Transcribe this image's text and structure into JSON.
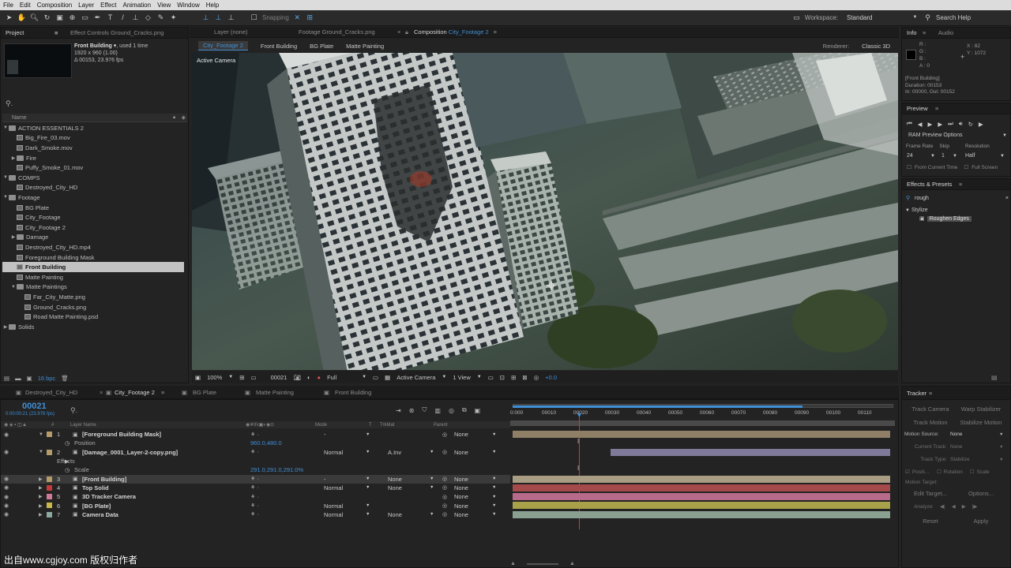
{
  "menubar": [
    "File",
    "Edit",
    "Composition",
    "Layer",
    "Effect",
    "Animation",
    "View",
    "Window",
    "Help"
  ],
  "toolbar": {
    "snapping": "Snapping",
    "workspace_label": "Workspace:",
    "workspace_value": "Standard",
    "search_help": "Search Help"
  },
  "project_panel": {
    "tabs": [
      "Project",
      "Effect Controls Ground_Cracks.png",
      "Layer (none)",
      "Footage Ground_Cracks.png"
    ],
    "comp_tab": "Composition",
    "comp_name": "City_Footage 2",
    "selected_name": "Front Building ▾",
    "used": ", used 1 time",
    "dims": "1920 x 960 (1.00)",
    "duration": "Δ 00153, 23.976 fps",
    "name_col": "Name",
    "bpc": "16 bpc",
    "items": [
      {
        "label": "ACTION ESSENTIALS 2",
        "type": "folder",
        "indent": 0,
        "tw": "▼"
      },
      {
        "label": "Big_Fire_03.mov",
        "type": "file",
        "indent": 1,
        "tw": ""
      },
      {
        "label": "Dark_Smoke.mov",
        "type": "file",
        "indent": 1,
        "tw": ""
      },
      {
        "label": "Fire",
        "type": "folder",
        "indent": 1,
        "tw": "▶"
      },
      {
        "label": "Puffy_Smoke_01.mov",
        "type": "file",
        "indent": 1,
        "tw": ""
      },
      {
        "label": "COMPS",
        "type": "folder",
        "indent": 0,
        "tw": "▼"
      },
      {
        "label": "Destroyed_City_HD",
        "type": "file",
        "indent": 1,
        "tw": ""
      },
      {
        "label": "Footage",
        "type": "folder",
        "indent": 0,
        "tw": "▼"
      },
      {
        "label": "BG Plate",
        "type": "file",
        "indent": 1,
        "tw": ""
      },
      {
        "label": "City_Footage",
        "type": "file",
        "indent": 1,
        "tw": ""
      },
      {
        "label": "City_Footage 2",
        "type": "file",
        "indent": 1,
        "tw": ""
      },
      {
        "label": "Damage",
        "type": "folder",
        "indent": 1,
        "tw": "▶"
      },
      {
        "label": "Destroyed_City_HD.mp4",
        "type": "file",
        "indent": 1,
        "tw": ""
      },
      {
        "label": "Foreground Building Mask",
        "type": "file",
        "indent": 1,
        "tw": ""
      },
      {
        "label": "Front Building",
        "type": "file",
        "indent": 1,
        "tw": "",
        "selected": true
      },
      {
        "label": "Matte Painting",
        "type": "file",
        "indent": 1,
        "tw": ""
      },
      {
        "label": "Matte Paintings",
        "type": "folder",
        "indent": 1,
        "tw": "▼"
      },
      {
        "label": "Far_City_Matte.png",
        "type": "file",
        "indent": 2,
        "tw": ""
      },
      {
        "label": "Ground_Cracks.png",
        "type": "file",
        "indent": 2,
        "tw": ""
      },
      {
        "label": "Road Matte Painting.psd",
        "type": "file",
        "indent": 2,
        "tw": ""
      },
      {
        "label": "Solids",
        "type": "folder",
        "indent": 0,
        "tw": "▶"
      }
    ]
  },
  "comp_viewer": {
    "tabs": [
      "City_Footage 2",
      "Front Building",
      "BG Plate",
      "Matte Painting"
    ],
    "renderer_label": "Renderer:",
    "renderer_value": "Classic 3D",
    "active_camera_label": "Active Camera",
    "bottom": {
      "zoom": "100%",
      "timecode": "00021",
      "resolution": "Full",
      "camera": "Active Camera",
      "views": "1 View",
      "exposure": "+0.0"
    }
  },
  "info_panel": {
    "tabs": [
      "Info",
      "Audio"
    ],
    "r": "R :",
    "g": "G :",
    "b": "B :",
    "a": "A : 0",
    "x": "X : 82",
    "y": "Y : 1072",
    "layer": "[Front Building]",
    "duration": "Duration: 00153",
    "inout": "In: 00000, Out: 00152"
  },
  "preview_panel": {
    "title": "Preview",
    "ram": "RAM Preview Options",
    "fr_label": "Frame Rate",
    "skip_label": "Skip",
    "res_label": "Resolution",
    "fr": "24",
    "skip": "1",
    "res": "Half",
    "from_current": "From Current Time",
    "full_screen": "Full Screen"
  },
  "effects_panel": {
    "title": "Effects & Presets",
    "search": "rough",
    "category": "Stylize",
    "effect": "Roughen Edges"
  },
  "timeline": {
    "tabs": [
      "Destroyed_City_HD",
      "City_Footage 2",
      "BG Plate",
      "Matte Painting",
      "Front Building"
    ],
    "timecode": "00021",
    "timecode_sub": "0:00:00:21 (23.976 fps)",
    "headers": {
      "layer_name": "Layer Name",
      "mode": "Mode",
      "t": "T",
      "trkmat": "TrkMat",
      "parent": "Parent"
    },
    "ruler": [
      "0:000",
      "00010",
      "00020",
      "00030",
      "00040",
      "00050",
      "00060",
      "00070",
      "00080",
      "00090",
      "00100",
      "00110"
    ],
    "rows": [
      {
        "num": "1",
        "name": "[Foreground Building Mask]",
        "color": "#b59a6a",
        "mode": "-",
        "trk": "",
        "parent": "None",
        "bar": "#8f7f67"
      },
      {
        "num": "",
        "name": "Position",
        "sub": true,
        "value": "960.0,480.0"
      },
      {
        "num": "2",
        "name": "[Damage_0001_Layer-2-copy.png]",
        "color": "#b59a6a",
        "mode": "Normal",
        "trk": "A.Inv",
        "parent": "None",
        "bar": "#7f7a9a"
      },
      {
        "num": "",
        "name": "Effects",
        "sub": true,
        "value": ""
      },
      {
        "num": "",
        "name": "Scale",
        "sub": true,
        "value": "291.0,291.0,291.0%"
      },
      {
        "num": "3",
        "name": "[Front Building]",
        "color": "#b59a6a",
        "mode": "-",
        "trk": "None",
        "parent": "None",
        "bar": "#a89c82"
      },
      {
        "num": "4",
        "name": "Top Solid",
        "color": "#c43a3a",
        "mode": "Normal",
        "trk": "None",
        "parent": "None",
        "bar": "#a44a4a"
      },
      {
        "num": "5",
        "name": "3D Tracker Camera",
        "color": "#d07a9a",
        "mode": "",
        "trk": "",
        "parent": "None",
        "bar": "#b76a8a"
      },
      {
        "num": "6",
        "name": "[BG Plate]",
        "color": "#c9b94a",
        "mode": "Normal",
        "trk": "",
        "parent": "None",
        "bar": "#a9a04a"
      },
      {
        "num": "7",
        "name": "Camera Data",
        "color": "#8aa9a0",
        "mode": "Normal",
        "trk": "None",
        "parent": "None",
        "bar": "#8aa090"
      }
    ]
  },
  "tracker_panel": {
    "title": "Tracker",
    "track_camera": "Track Camera",
    "warp_stabilizer": "Warp Stabilizer",
    "track_motion": "Track Motion",
    "stabilize_motion": "Stabilize Motion",
    "motion_source_label": "Motion Source:",
    "motion_source": "None",
    "current_track_label": "Current Track:",
    "current_track": "None",
    "track_type_label": "Track Type:",
    "track_type": "Stabilize",
    "position": "Positi...",
    "rotation": "Rotation",
    "scale": "Scale",
    "motion_target": "Motion Target:",
    "edit_target": "Edit Target...",
    "options": "Options...",
    "analyze": "Analyze:",
    "reset": "Reset",
    "apply": "Apply"
  },
  "watermark": "出自www.cgjoy.com 版权归作者"
}
